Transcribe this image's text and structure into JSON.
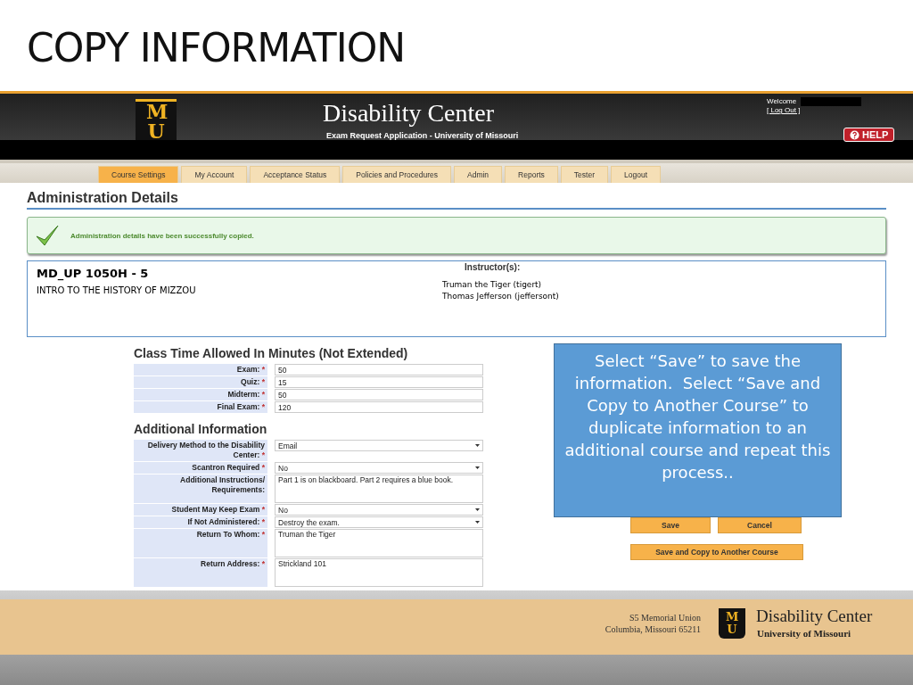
{
  "slide_title": "COPY INFORMATION",
  "header": {
    "logo": "MU",
    "title": "Disability Center",
    "subtitle": "Exam Request Application - University of Missouri",
    "welcome": "Welcome",
    "logout": "[ Log Out ]",
    "help": "HELP"
  },
  "tabs": [
    {
      "label": "Course Settings",
      "selected": true
    },
    {
      "label": "My Account",
      "selected": false
    },
    {
      "label": "Acceptance Status",
      "selected": false
    },
    {
      "label": "Policies and Procedures",
      "selected": false
    },
    {
      "label": "Admin",
      "selected": false
    },
    {
      "label": "Reports",
      "selected": false
    },
    {
      "label": "Tester",
      "selected": false
    },
    {
      "label": "Logout",
      "selected": false
    }
  ],
  "page_heading": "Administration Details",
  "success_message": "Administration details have been successfully copied.",
  "course": {
    "code": "MD_UP 1050H - 5",
    "name": "INTRO TO THE HISTORY OF MIZZOU",
    "instructors_label": "Instructor(s):",
    "instructors": [
      "Truman the Tiger (tigert)",
      "Thomas Jefferson (jeffersont)"
    ]
  },
  "class_time": {
    "heading": "Class Time Allowed In Minutes (Not Extended)",
    "fields": [
      {
        "label": "Exam:",
        "value": "50",
        "kind": "text"
      },
      {
        "label": "Quiz:",
        "value": "15",
        "kind": "text"
      },
      {
        "label": "Midterm:",
        "value": "50",
        "kind": "text"
      },
      {
        "label": "Final Exam:",
        "value": "120",
        "kind": "text"
      }
    ]
  },
  "additional": {
    "heading": "Additional Information",
    "fields": [
      {
        "label": "Delivery Method to the Disability Center:",
        "value": "Email",
        "kind": "select"
      },
      {
        "label": "Scantron Required",
        "value": "No",
        "kind": "select"
      },
      {
        "label": "Additional Instructions/ Requirements:",
        "value": "Part 1 is on blackboard.  Part 2 requires a blue book.",
        "kind": "textarea",
        "required": false
      },
      {
        "label": "Student May Keep Exam",
        "value": "No",
        "kind": "select"
      },
      {
        "label": "If Not Administered:",
        "value": "Destroy the exam.",
        "kind": "select"
      },
      {
        "label": "Return To Whom:",
        "value": "Truman the Tiger",
        "kind": "textarea"
      },
      {
        "label": "Return Address:",
        "value": "Strickland 101",
        "kind": "textarea"
      }
    ]
  },
  "required_mark": "*",
  "buttons": {
    "save": "Save",
    "cancel": "Cancel",
    "save_copy": "Save and Copy to Another Course"
  },
  "callout": "Select “Save” to save the information.  Select “Save and Copy to Another Course” to duplicate information to an additional course and repeat this process..",
  "footer": {
    "address": [
      "S5 Memorial Union",
      "Columbia, Missouri 65211"
    ],
    "logo": "MU",
    "title": "Disability Center",
    "subtitle": "University of Missouri"
  }
}
